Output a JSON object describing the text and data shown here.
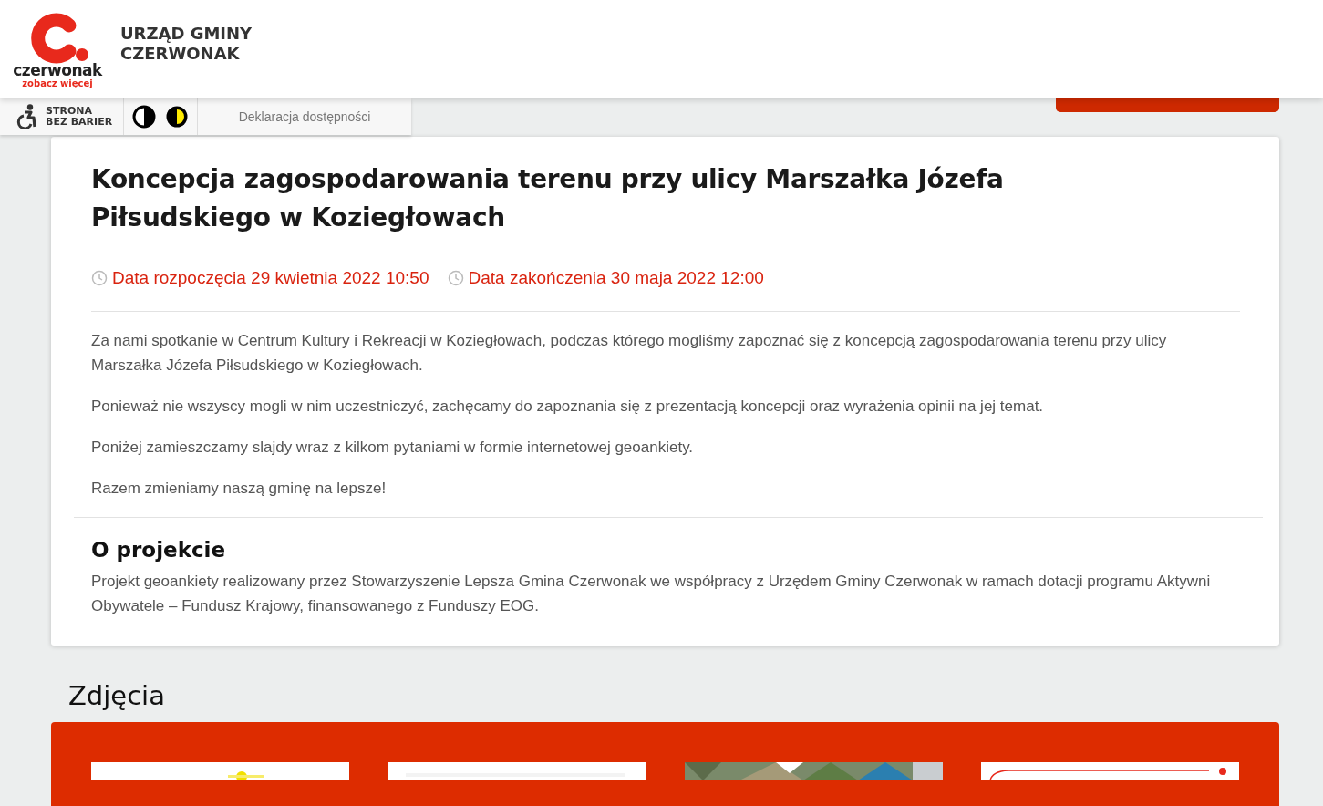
{
  "header": {
    "logo": {
      "wordmark": "czerwonak",
      "tagline": "zobacz więcej"
    },
    "title_lines": [
      "URZĄD GMINY",
      "CZERWONAK"
    ]
  },
  "accessibility_bar": {
    "label_lines": [
      "STRONA",
      "BEZ BARIER"
    ],
    "declaration_link": "Deklaracja dostępności"
  },
  "article": {
    "title": "Koncepcja zagospodarowania terenu przy ulicy Marszałka Józefa Piłsudskiego w Koziegłowach",
    "dates": [
      "Data rozpoczęcia 29 kwietnia 2022 10:50",
      "Data zakończenia 30 maja 2022 12:00"
    ],
    "paragraphs": [
      "Za nami spotkanie w Centrum Kultury i Rekreacji w Koziegłowach, podczas którego mogliśmy zapoznać się z koncepcją zagospodarowania terenu przy ulicy Marszałka Józefa Piłsudskiego w Koziegłowach.",
      "Ponieważ nie wszyscy mogli w nim uczestniczyć, zachęcamy do zapoznania się z prezentacją koncepcji oraz wyrażenia opinii na jej temat.",
      "Poniżej zamieszczamy slajdy wraz z kilkom pytaniami w formie internetowej geoankiety.",
      "Razem zmieniamy naszą gminę na lepsze!"
    ],
    "section": {
      "heading": "O projekcie",
      "text": "Projekt geoankiety realizowany przez Stowarzyszenie Lepsza Gmina Czerwonak we współpracy z Urzędem Gminy Czerwonak w ramach dotacji programu Aktywni Obywatele – Fundusz Krajowy, finansowanego z Funduszy EOG."
    }
  },
  "photos": {
    "heading": "Zdjęcia"
  }
}
